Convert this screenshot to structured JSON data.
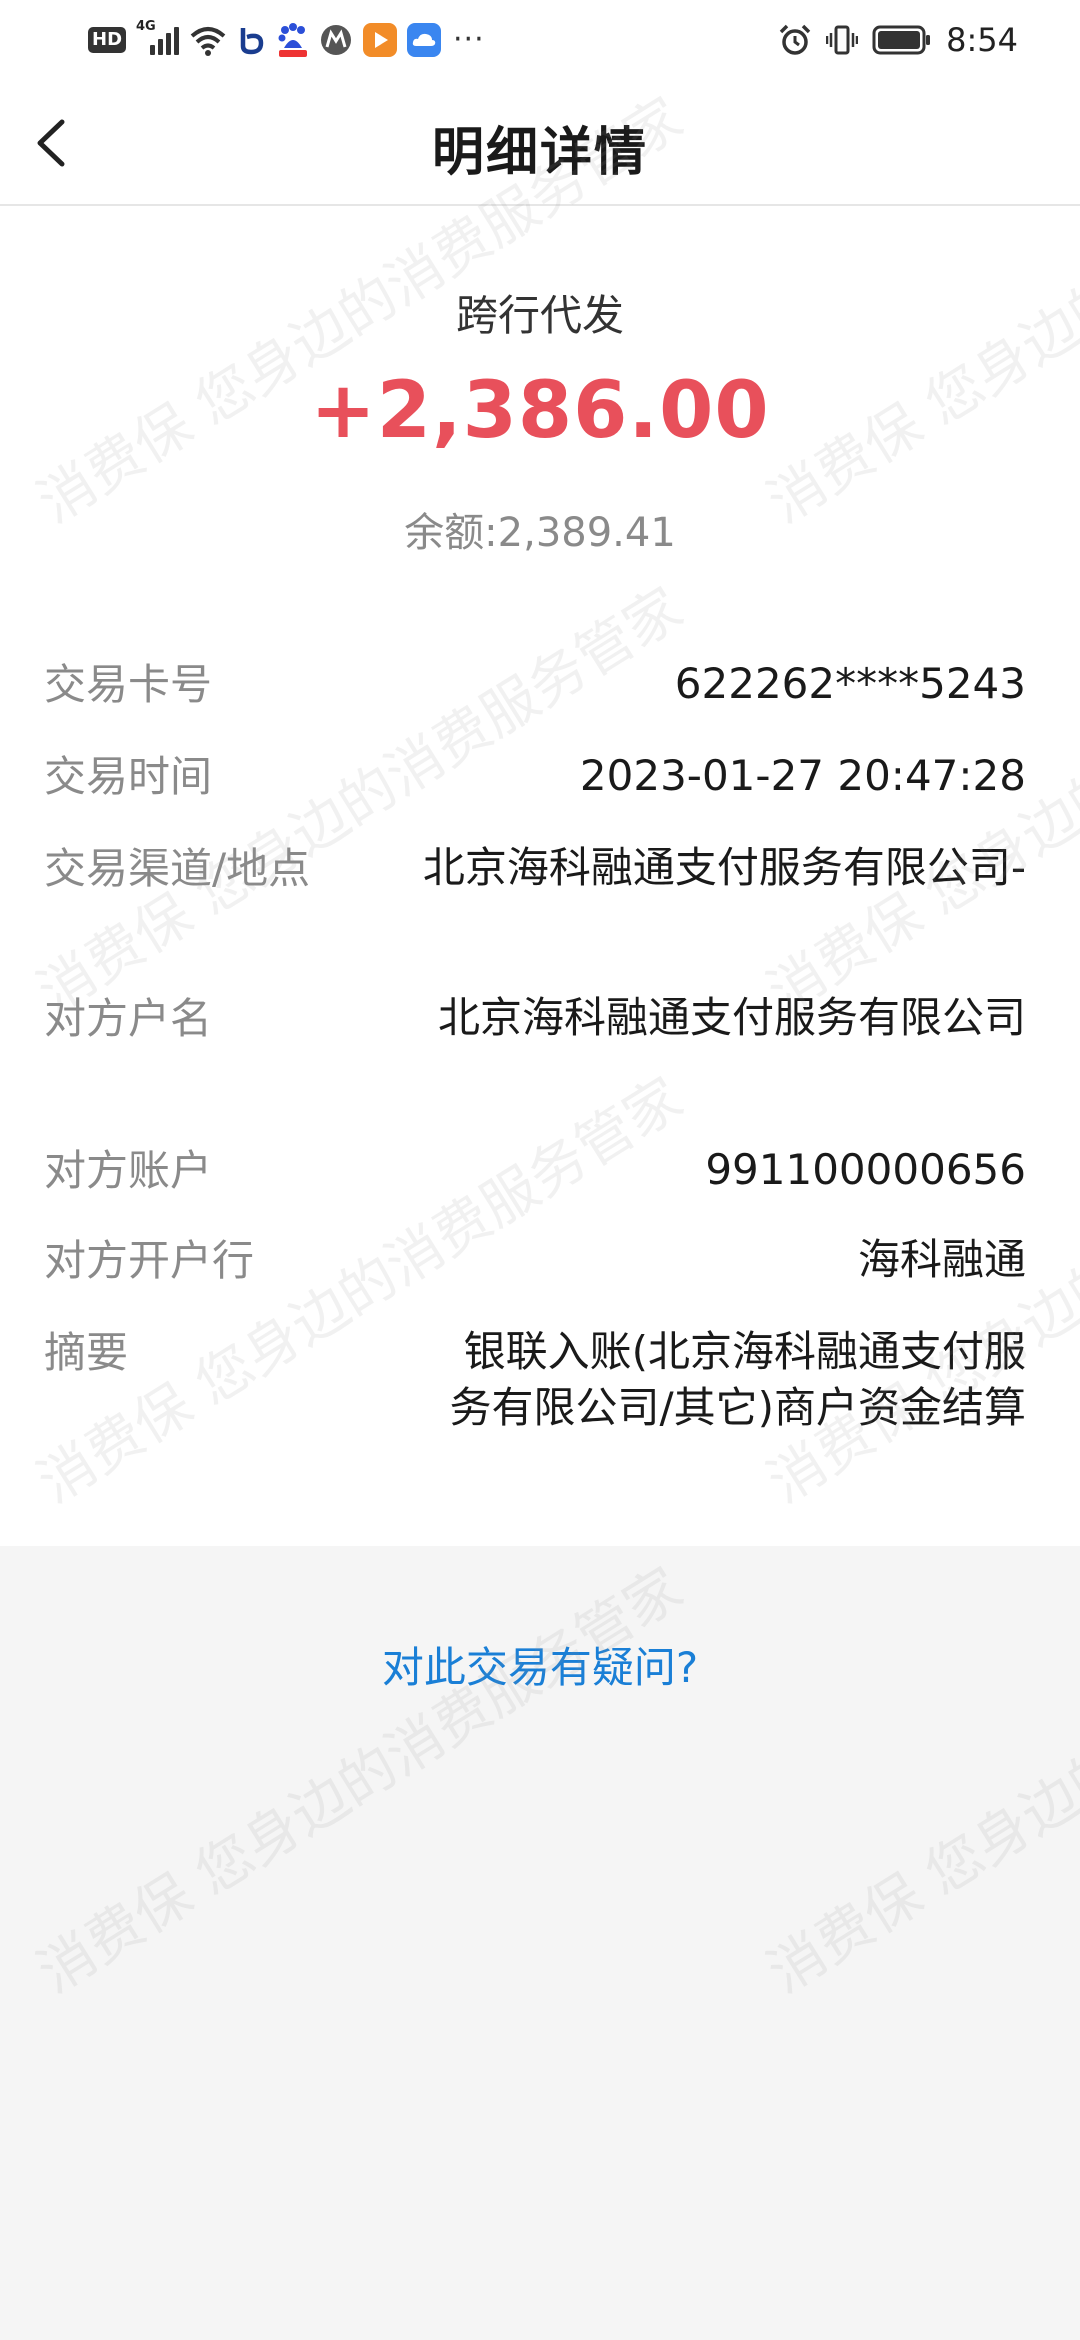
{
  "status_bar": {
    "hd_label": "HD",
    "network_label": "4G",
    "time": "8:54",
    "more_label": "···"
  },
  "nav": {
    "title": "明细详情"
  },
  "transaction": {
    "type": "跨行代发",
    "amount": "+2,386.00",
    "balance": "余额:2,389.41",
    "amount_color": "#e8505b"
  },
  "details": [
    {
      "label": "交易卡号",
      "value": "622262****5243"
    },
    {
      "label": "交易时间",
      "value": "2023-01-27 20:47:28"
    },
    {
      "label": "交易渠道/地点",
      "value": "北京海科融通支付服务有限公司-"
    },
    {
      "label": "对方户名",
      "value": "北京海科融通支付服务有限公司"
    },
    {
      "label": "对方账户",
      "value": "991100000656"
    },
    {
      "label": "对方开户行",
      "value": "海科融通"
    },
    {
      "label": "摘要",
      "value": "银联入账(北京海科融通支付服务有限公司/其它)商户资金结算"
    }
  ],
  "ask_link": "对此交易有疑问?",
  "watermark": "消费保 您身边的消费服务管家",
  "colors": {
    "link": "#1a7fd6",
    "label": "#8a8a8a",
    "background": "#f5f5f5"
  }
}
